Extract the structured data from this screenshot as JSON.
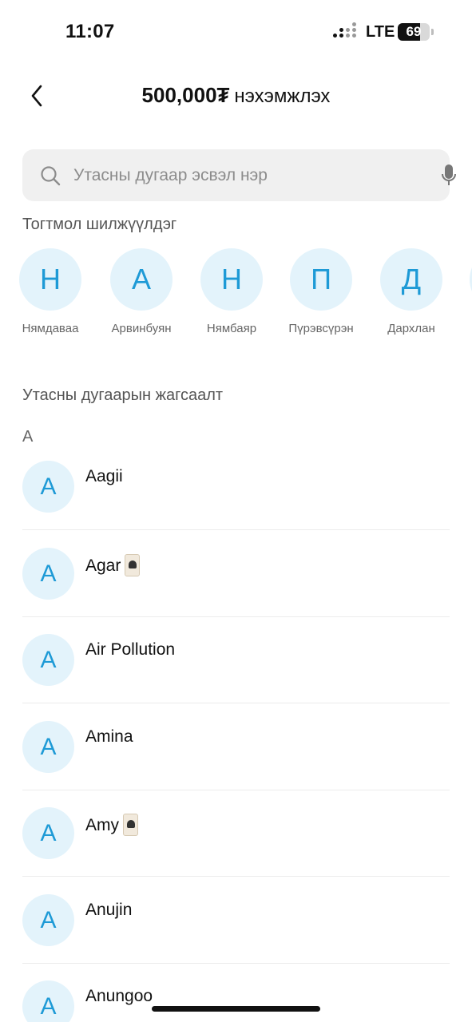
{
  "status_bar": {
    "time": "11:07",
    "network": "LTE",
    "battery": "69"
  },
  "header": {
    "amount": "500,000₮",
    "title": "нэхэмжлэх"
  },
  "search": {
    "placeholder": "Утасны дугаар эсвэл нэр"
  },
  "frequent": {
    "label": "Тогтмол шилжүүлдэг",
    "items": [
      {
        "initial": "Н",
        "name": "Нямдаваа"
      },
      {
        "initial": "А",
        "name": "Арвинбуян"
      },
      {
        "initial": "Н",
        "name": "Нямбаяр"
      },
      {
        "initial": "П",
        "name": "Пүрэвсүрэн"
      },
      {
        "initial": "Д",
        "name": "Дархлан"
      }
    ]
  },
  "contacts": {
    "label": "Утасны дугаарын жагсаалт",
    "letter": "A",
    "items": [
      {
        "initial": "A",
        "name": "Aagii"
      },
      {
        "initial": "A",
        "name": "Agar"
      },
      {
        "initial": "A",
        "name": "Air Pollution"
      },
      {
        "initial": "A",
        "name": "Amina"
      },
      {
        "initial": "A",
        "name": "Amy"
      },
      {
        "initial": "A",
        "name": "Anujin"
      },
      {
        "initial": "A",
        "name": "Anungoo"
      }
    ]
  },
  "colors": {
    "accent": "#1e9ad6",
    "avatar_bg": "#e3f3fb",
    "search_bg": "#f0f0f0"
  }
}
